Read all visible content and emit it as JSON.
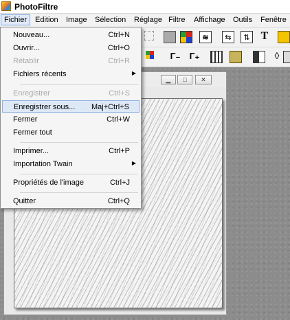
{
  "app": {
    "title": "PhotoFiltre"
  },
  "menubar": {
    "items": [
      "Fichier",
      "Edition",
      "Image",
      "Sélection",
      "Réglage",
      "Filtre",
      "Affichage",
      "Outils",
      "Fenêtre"
    ]
  },
  "toolbar": {
    "text_tool_glyph": "T",
    "gamma_minus_glyph": "Γ₋",
    "gamma_plus_glyph": "Γ₊",
    "drop_glyph": "◊",
    "colors": {
      "red": "#d9251c",
      "blue": "#1b3fd1",
      "yellow": "#f2c400",
      "green": "#2f9a2f"
    }
  },
  "file_menu": {
    "items": [
      {
        "label": "Nouveau...",
        "shortcut": "Ctrl+N",
        "enabled": true
      },
      {
        "label": "Ouvrir...",
        "shortcut": "Ctrl+O",
        "enabled": true
      },
      {
        "label": "Rétablir",
        "shortcut": "Ctrl+R",
        "enabled": false
      },
      {
        "label": "Fichiers récents",
        "submenu": true,
        "enabled": true
      },
      {
        "label": "Enregistrer",
        "shortcut": "Ctrl+S",
        "enabled": false
      },
      {
        "label": "Enregistrer sous...",
        "shortcut": "Maj+Ctrl+S",
        "enabled": true,
        "highlighted": true
      },
      {
        "label": "Fermer",
        "shortcut": "Ctrl+W",
        "enabled": true
      },
      {
        "label": "Fermer tout",
        "enabled": true
      },
      {
        "label": "Imprimer...",
        "shortcut": "Ctrl+P",
        "enabled": true
      },
      {
        "label": "Importation Twain",
        "submenu": true,
        "enabled": true
      },
      {
        "label": "Propriétés de l'image",
        "shortcut": "Ctrl+J",
        "enabled": true
      },
      {
        "label": "Quitter",
        "shortcut": "Ctrl+Q",
        "enabled": true
      }
    ],
    "submenu_arrow": "▶"
  },
  "document_window": {
    "minimize_glyph": "▁",
    "maximize_glyph": "□",
    "close_glyph": "✕"
  }
}
